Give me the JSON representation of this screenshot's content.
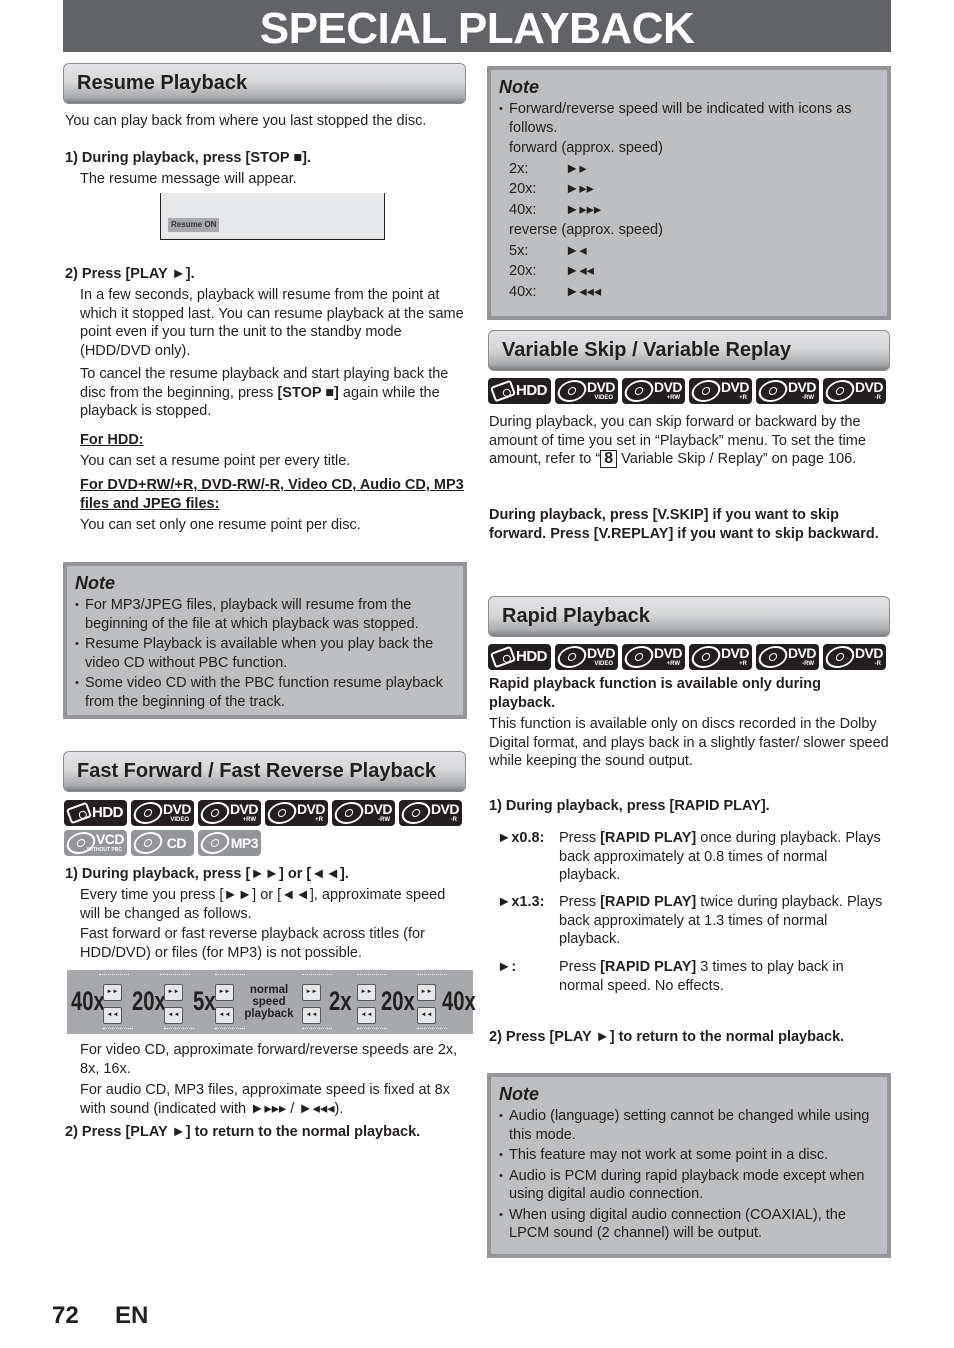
{
  "page_title": "SPECIAL PLAYBACK",
  "resume": {
    "heading": "Resume Playback",
    "intro": "You can play back from where you last stopped the disc.",
    "step1_title": "1) During playback, press [STOP ■].",
    "step1_text": "The resume message will appear.",
    "screen_label": "Resume ON",
    "step2_title": "2) Press [PLAY ►].",
    "step2_p1": "In a few seconds, playback will resume from the point at which it stopped last. You can resume playback at the same point even if you turn the unit to the standby mode (HDD/DVD only).",
    "step2_p2_a": "To cancel the resume playback and start playing back the disc from the beginning, press ",
    "step2_p2_b": "[STOP ■]",
    "step2_p2_c": " again while the playback is stopped.",
    "hdd_heading": "For HDD:",
    "hdd_text": "You can set a resume point per every title.",
    "disc_heading": "For DVD+RW/+R, DVD-RW/-R, Video CD, Audio CD, MP3 files and JPEG files:",
    "disc_text": "You can set only one resume point per disc."
  },
  "resume_note": {
    "title": "Note",
    "items": [
      "For MP3/JPEG files, playback will resume from the beginning of the file at which playback was stopped.",
      "Resume Playback is available when you play back the video CD without PBC function.",
      "Some video CD with the PBC function resume playback from the beginning of the track."
    ]
  },
  "ff": {
    "heading": "Fast Forward / Fast Reverse Playback",
    "badges_row1": [
      {
        "label": "HDD",
        "sub": "",
        "icon": "hdd-icon"
      },
      {
        "label": "DVD",
        "sub": "VIDEO",
        "icon": "disc-icon"
      },
      {
        "label": "DVD",
        "sub": "+RW",
        "icon": "disc-icon"
      },
      {
        "label": "DVD",
        "sub": "+R",
        "icon": "disc-icon"
      },
      {
        "label": "DVD",
        "sub": "-RW",
        "icon": "disc-icon"
      },
      {
        "label": "DVD",
        "sub": "-R",
        "icon": "disc-icon"
      }
    ],
    "badges_row2": [
      {
        "label": "VCD",
        "sub": "WITHOUT PBC",
        "icon": "disc-icon"
      },
      {
        "label": "CD",
        "sub": "",
        "icon": "disc-icon"
      },
      {
        "label": "MP3",
        "sub": "",
        "icon": "disc-icon"
      }
    ],
    "step1_title": "1) During playback, press [►►] or [◄◄].",
    "step1_p1": "Every time you press [►►] or [◄◄], approximate speed will be changed as follows.",
    "step1_p2": "Fast forward or fast reverse playback across titles (for HDD/DVD) or files (for MP3) is not possible.",
    "speeds": [
      "40x",
      "20x",
      "5x",
      "2x",
      "20x",
      "40x"
    ],
    "normal_label": [
      "normal",
      "speed",
      "playback"
    ],
    "ff_btn": "►►",
    "rew_btn": "◄◄",
    "vcd_text": "For video CD, approximate forward/reverse speeds are 2x, 8x, 16x.",
    "cd_text": "For audio CD, MP3 files, approximate speed is fixed at 8x with sound (indicated with ►▸▸▸ / ►◂◂◂).",
    "step2_title": "2) Press [PLAY ►] to return to the normal playback."
  },
  "speed_note": {
    "title": "Note",
    "item": "Forward/reverse speed will be indicated with icons as follows.",
    "forward_heading": "forward (approx. speed)",
    "forward": [
      {
        "speed": "2x:",
        "icon": "►▸"
      },
      {
        "speed": "20x:",
        "icon": "►▸▸"
      },
      {
        "speed": "40x:",
        "icon": "►▸▸▸"
      }
    ],
    "reverse_heading": "reverse (approx. speed)",
    "reverse": [
      {
        "speed": "5x:",
        "icon": "►◂"
      },
      {
        "speed": "20x:",
        "icon": "►◂◂"
      },
      {
        "speed": "40x:",
        "icon": "►◂◂◂"
      }
    ]
  },
  "vskip": {
    "heading": "Variable Skip / Variable Replay",
    "badges": [
      {
        "label": "HDD",
        "sub": ""
      },
      {
        "label": "DVD",
        "sub": "VIDEO"
      },
      {
        "label": "DVD",
        "sub": "+RW"
      },
      {
        "label": "DVD",
        "sub": "+R"
      },
      {
        "label": "DVD",
        "sub": "-RW"
      },
      {
        "label": "DVD",
        "sub": "-R"
      }
    ],
    "p1_a": "During playback, you can skip forward or backward by the amount of time you set in “Playback” menu. To set the time amount, refer to “",
    "p1_ref": "8",
    "p1_b": " Variable Skip / Replay” on page 106.",
    "instruction": "During playback, press [V.SKIP] if you want to skip forward. Press [V.REPLAY] if you want to skip backward."
  },
  "rapid": {
    "heading": "Rapid Playback",
    "badges": [
      {
        "label": "HDD",
        "sub": ""
      },
      {
        "label": "DVD",
        "sub": "VIDEO"
      },
      {
        "label": "DVD",
        "sub": "+RW"
      },
      {
        "label": "DVD",
        "sub": "+R"
      },
      {
        "label": "DVD",
        "sub": "-RW"
      },
      {
        "label": "DVD",
        "sub": "-R"
      }
    ],
    "bold_intro": "Rapid playback function is available only during playback.",
    "intro": "This function is available only on discs recorded in the Dolby Digital format, and plays back in a slightly faster/ slower speed while keeping the sound output.",
    "step1_title": "1) During playback, press [RAPID PLAY].",
    "rows": [
      {
        "key": "►x0.8:",
        "pre": "Press ",
        "btn": "[RAPID PLAY]",
        "post": " once during playback. Plays back approximately at 0.8 times of normal playback."
      },
      {
        "key": "►x1.3:",
        "pre": "Press ",
        "btn": "[RAPID PLAY]",
        "post": " twice during playback. Plays back approximately at 1.3 times of normal playback."
      },
      {
        "key": "►:",
        "pre": "Press ",
        "btn": "[RAPID PLAY]",
        "post": " 3 times to play back in normal speed. No effects."
      }
    ],
    "step2_title": "2) Press [PLAY ►] to return to the normal playback."
  },
  "rapid_note": {
    "title": "Note",
    "items": [
      "Audio (language) setting cannot be changed while using this mode.",
      "This feature may not work at some point in a disc.",
      "Audio is PCM during rapid playback mode except when using digital audio connection.",
      "When using digital audio connection (COAXIAL), the LPCM sound (2 channel) will be output."
    ]
  },
  "footer": {
    "page": "72",
    "lang": "EN"
  }
}
